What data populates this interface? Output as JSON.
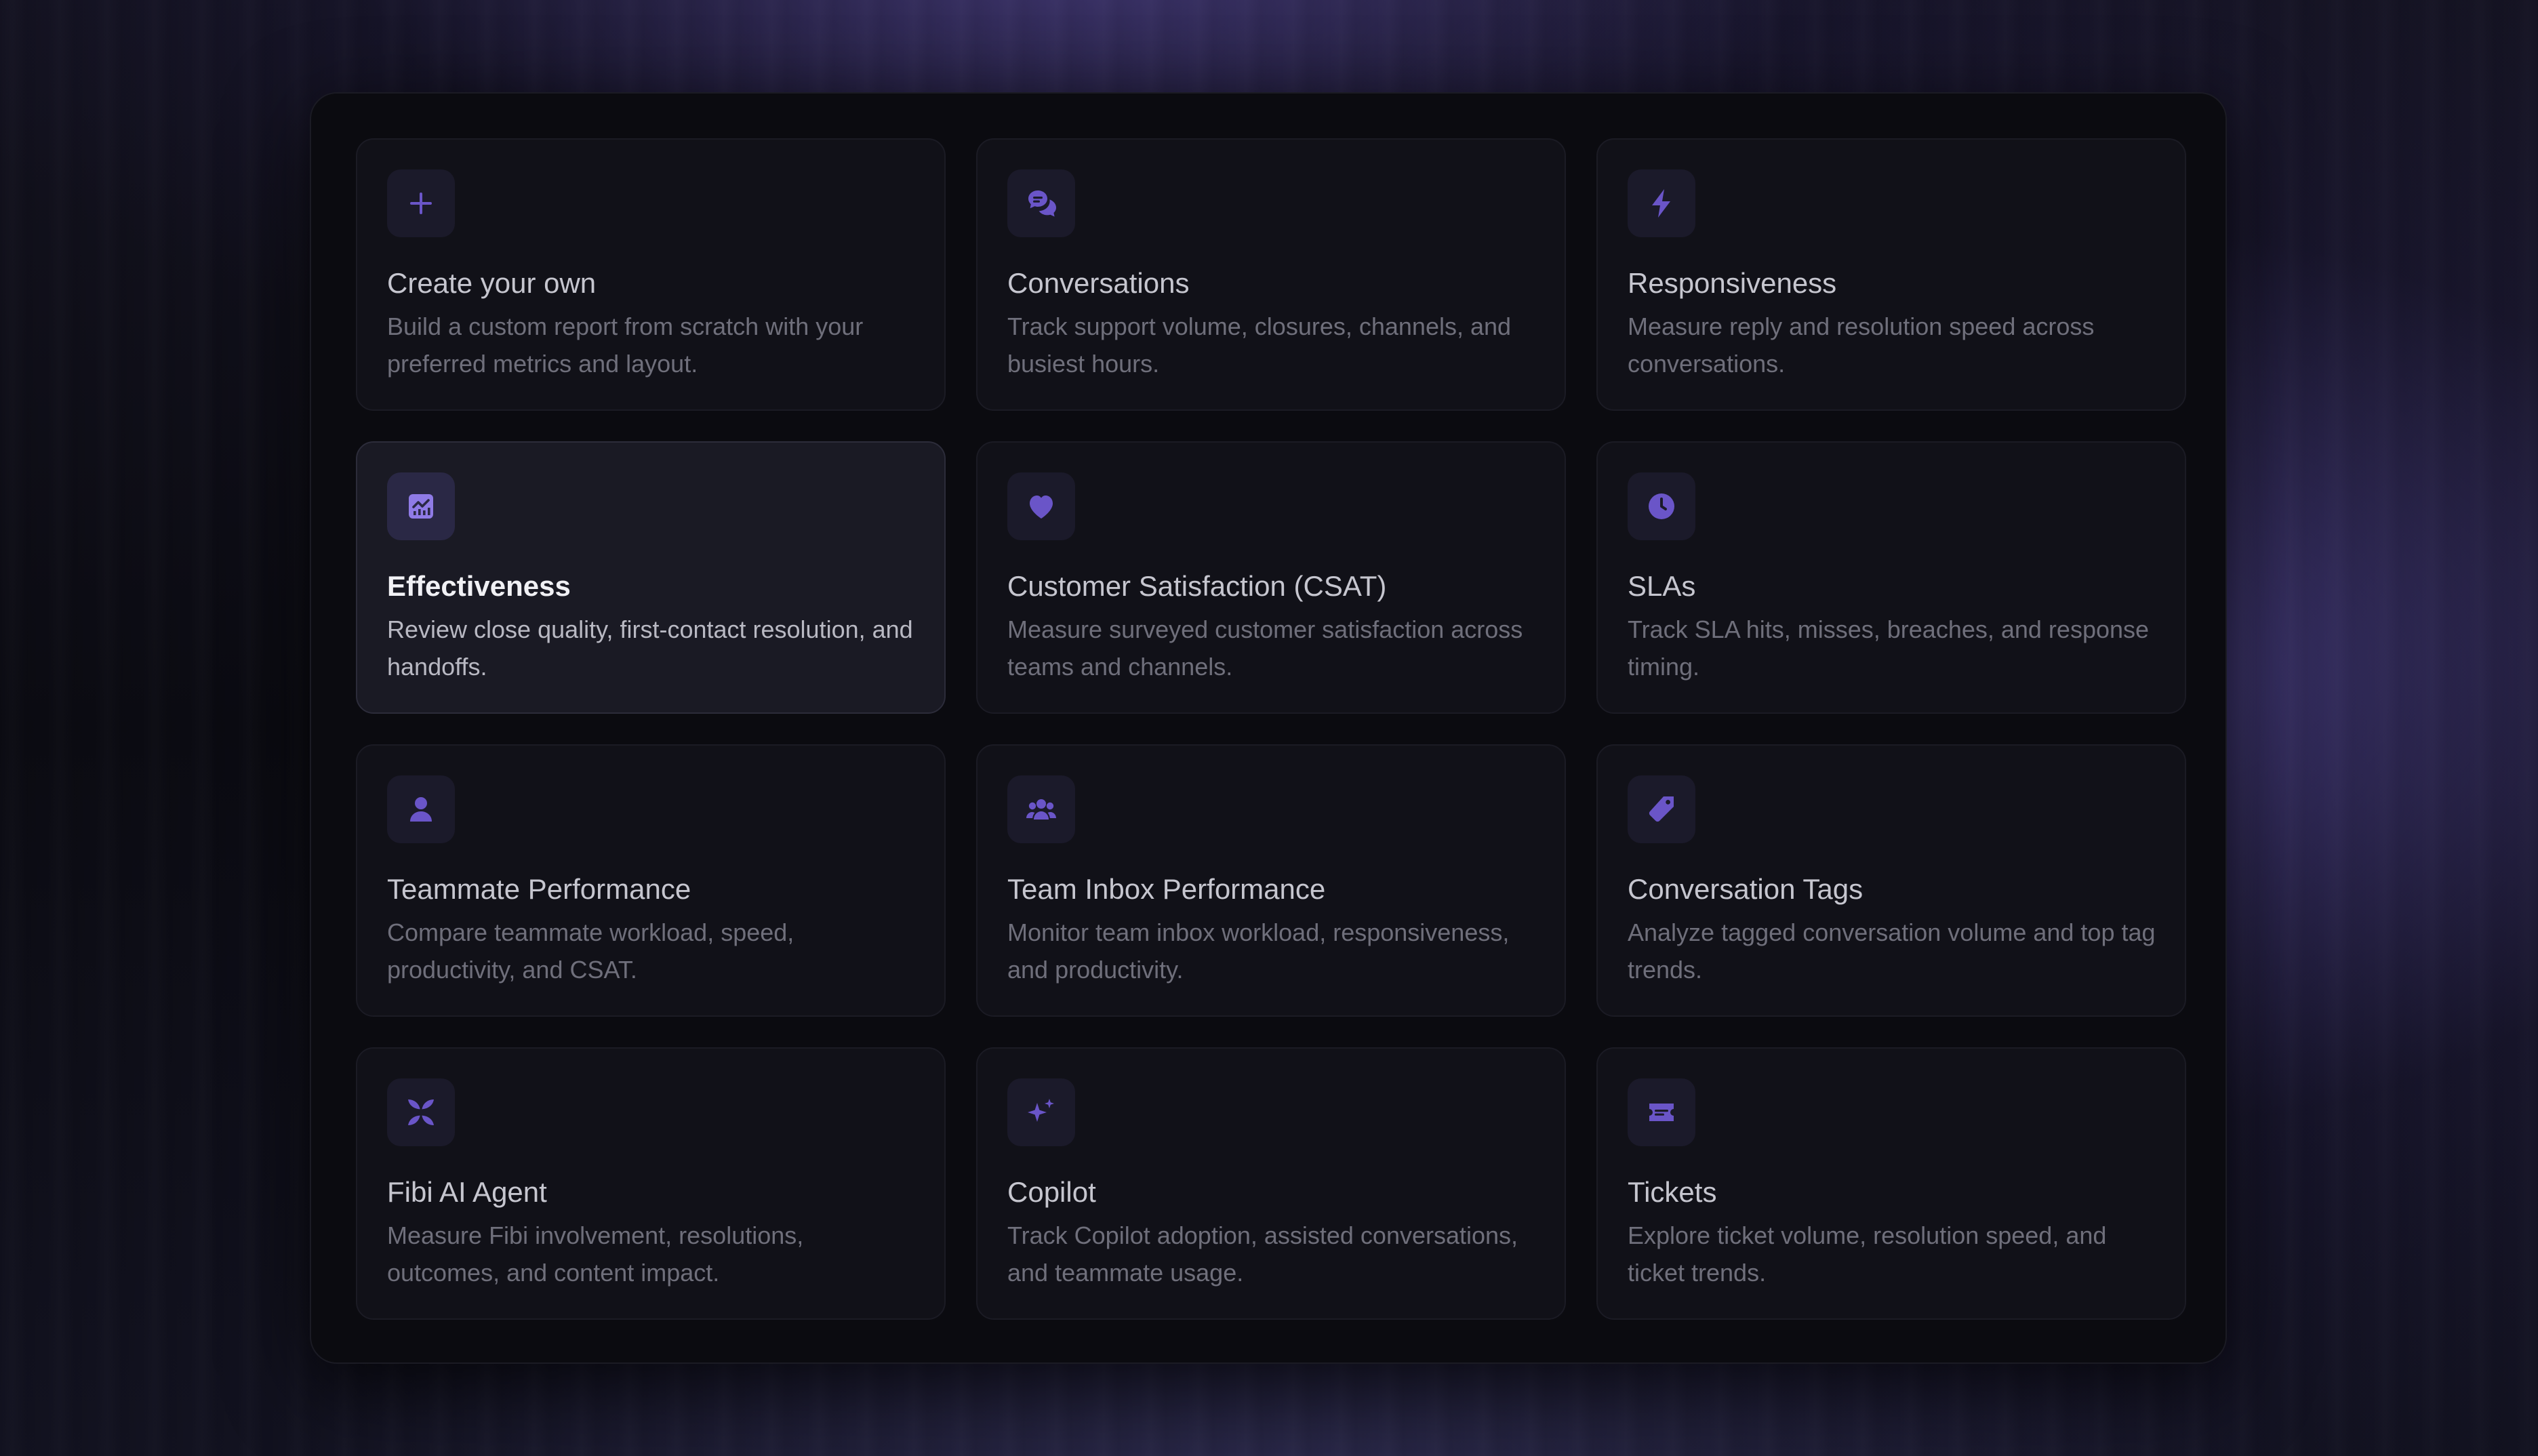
{
  "colors": {
    "accent": "#6a55c8",
    "accent_active": "#8f7be6",
    "card_bg": "#111118",
    "card_active_bg": "#1a1a24"
  },
  "reports": [
    {
      "title": "Create your own",
      "description": "Build a custom report from scratch with your preferred metrics and layout.",
      "icon": "plus-icon"
    },
    {
      "title": "Conversations",
      "description": "Track support volume, closures, channels, and busiest hours.",
      "icon": "chat-bubbles-icon"
    },
    {
      "title": "Responsiveness",
      "description": "Measure reply and resolution speed across conversations.",
      "icon": "lightning-icon"
    },
    {
      "title": "Effectiveness",
      "description": "Review close quality, first-contact resolution, and handoffs.",
      "icon": "chart-up-icon",
      "active": true
    },
    {
      "title": "Customer Satisfaction (CSAT)",
      "description": "Measure surveyed customer satisfaction across teams and channels.",
      "icon": "heart-icon"
    },
    {
      "title": "SLAs",
      "description": "Track SLA hits, misses, breaches, and response timing.",
      "icon": "clock-icon"
    },
    {
      "title": "Teammate Performance",
      "description": "Compare teammate workload, speed, productivity, and CSAT.",
      "icon": "person-icon"
    },
    {
      "title": "Team Inbox Performance",
      "description": "Monitor team inbox workload, responsiveness, and productivity.",
      "icon": "team-icon"
    },
    {
      "title": "Conversation Tags",
      "description": "Analyze tagged conversation volume and top tag trends.",
      "icon": "tag-icon"
    },
    {
      "title": "Fibi AI Agent",
      "description": "Measure Fibi involvement, resolutions, outcomes, and content impact.",
      "icon": "fibi-logo-icon"
    },
    {
      "title": "Copilot",
      "description": "Track Copilot adoption, assisted conversations, and teammate usage.",
      "icon": "sparkles-icon"
    },
    {
      "title": "Tickets",
      "description": "Explore ticket volume, resolution speed, and ticket trends.",
      "icon": "ticket-icon"
    }
  ]
}
